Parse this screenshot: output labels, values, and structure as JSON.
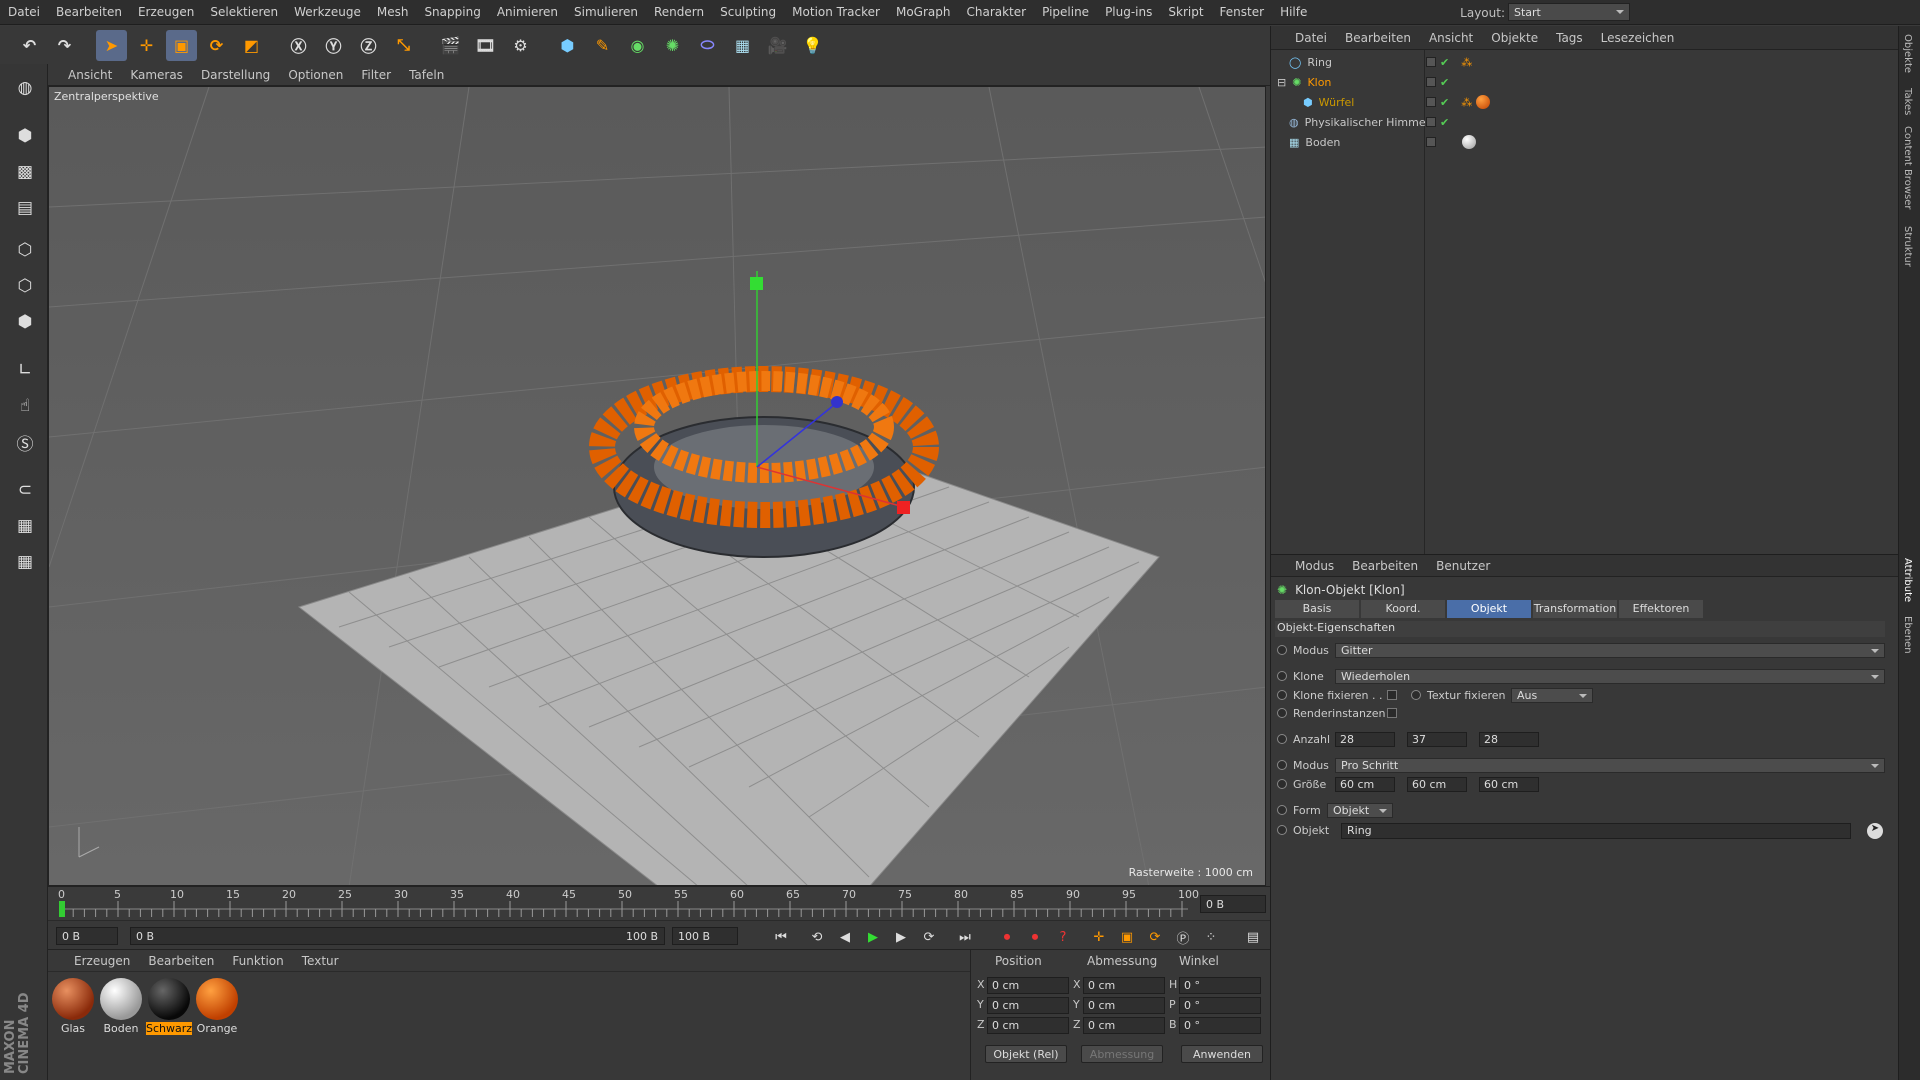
{
  "menubar": {
    "items": [
      "Datei",
      "Bearbeiten",
      "Erzeugen",
      "Selektieren",
      "Werkzeuge",
      "Mesh",
      "Snapping",
      "Animieren",
      "Simulieren",
      "Rendern",
      "Sculpting",
      "Motion Tracker",
      "MoGraph",
      "Charakter",
      "Pipeline",
      "Plug-ins",
      "Skript",
      "Fenster",
      "Hilfe"
    ],
    "layout_label": "Layout:",
    "layout_value": "Start"
  },
  "viewport": {
    "menu": [
      "Ansicht",
      "Kameras",
      "Darstellung",
      "Optionen",
      "Filter",
      "Tafeln"
    ],
    "label": "Zentralperspektive",
    "raster": "Rasterweite : 1000 cm"
  },
  "timeline": {
    "ticks": [
      "0",
      "5",
      "10",
      "15",
      "20",
      "25",
      "30",
      "35",
      "40",
      "45",
      "50",
      "55",
      "60",
      "65",
      "70",
      "75",
      "80",
      "85",
      "90",
      "95",
      "100"
    ],
    "frame_field": "0 B"
  },
  "transport": {
    "start": "0 B",
    "range_start": "0 B",
    "range_end": "100 B",
    "end": "100 B"
  },
  "materials": {
    "menu": [
      "Erzeugen",
      "Bearbeiten",
      "Funktion",
      "Textur"
    ],
    "items": [
      "Glas",
      "Boden",
      "Schwarz",
      "Orange"
    ]
  },
  "coords": {
    "headers": [
      "Position",
      "Abmessung",
      "Winkel"
    ],
    "axes": [
      "X",
      "Y",
      "Z"
    ],
    "axes2": [
      "X",
      "Y",
      "Z"
    ],
    "axes3": [
      "H",
      "P",
      "B"
    ],
    "pos": [
      "0 cm",
      "0 cm",
      "0 cm"
    ],
    "size": [
      "0 cm",
      "0 cm",
      "0 cm"
    ],
    "rot": [
      "0 °",
      "0 °",
      "0 °"
    ],
    "mode": "Objekt (Rel)",
    "size_mode": "Abmessung",
    "apply": "Anwenden"
  },
  "brand": "MAXON CINEMA 4D",
  "objects": {
    "menu": [
      "Datei",
      "Bearbeiten",
      "Ansicht",
      "Objekte",
      "Tags",
      "Lesezeichen"
    ],
    "items": [
      "Ring",
      "Klon",
      "Würfel",
      "Physikalischer Himmel",
      "Boden"
    ]
  },
  "attributes": {
    "menu": [
      "Modus",
      "Bearbeiten",
      "Benutzer"
    ],
    "title": "Klon-Objekt [Klon]",
    "tabs": [
      "Basis",
      "Koord.",
      "Objekt",
      "Transformation",
      "Effektoren"
    ],
    "section": "Objekt-Eigenschaften",
    "modus_label": "Modus",
    "modus_value": "Gitter",
    "klone_label": "Klone",
    "klone_value": "Wiederholen",
    "fix_label": "Klone fixieren . .",
    "tex_label": "Textur fixieren",
    "tex_value": "Aus",
    "render_label": "Renderinstanzen",
    "anzahl_label": "Anzahl",
    "anzahl": [
      "28",
      "37",
      "28"
    ],
    "modus2_label": "Modus",
    "modus2_value": "Pro Schritt",
    "groesse_label": "Größe",
    "groesse": [
      "60 cm",
      "60 cm",
      "60 cm"
    ],
    "form_label": "Form",
    "form_value": "Objekt",
    "objekt_label": "Objekt",
    "objekt_value": "Ring"
  },
  "sidetabs": [
    "Objekte",
    "Takes",
    "Content Browser",
    "Struktur",
    "Attribute",
    "Ebenen"
  ]
}
